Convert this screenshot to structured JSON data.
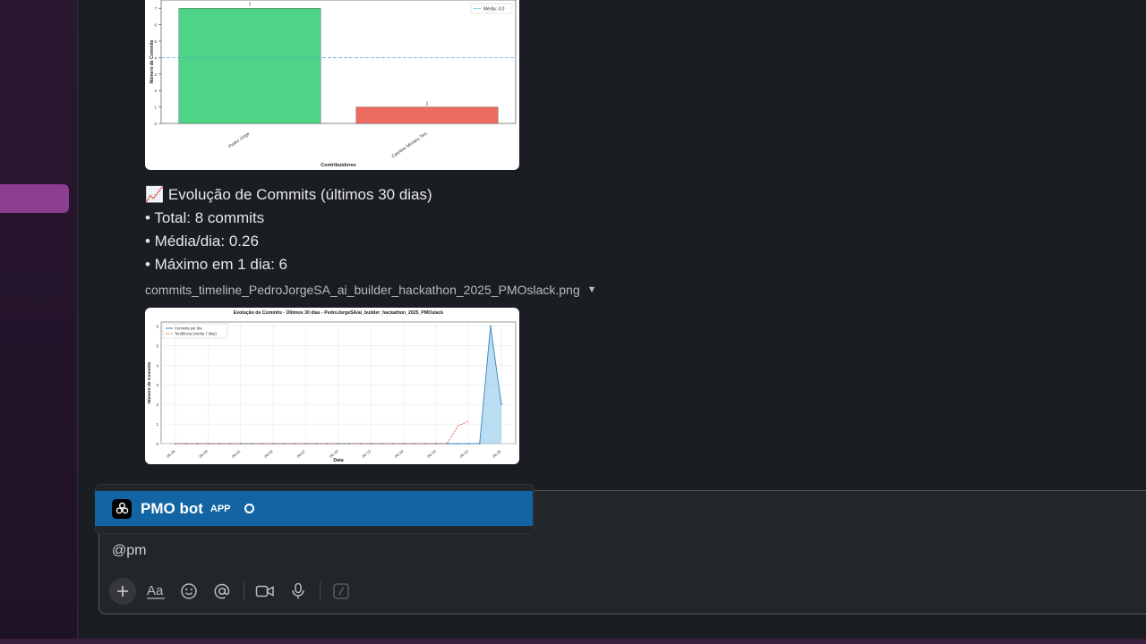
{
  "message": {
    "timeline_title": "📈 Evolução de Commits (últimos 30 dias)",
    "total": "• Total: 8 commits",
    "avg": "• Média/dia: 0.26",
    "max": "• Máximo em 1 dia: 6",
    "file_name": "commits_timeline_PedroJorgeSA_ai_builder_hackathon_2025_PMOslack.png"
  },
  "composer": {
    "text": "@pm"
  },
  "mention": {
    "name": "PMO bot",
    "badge": "APP"
  },
  "colors": {
    "accent_selected": "#1264a3",
    "sidebar_active": "#8c3f8f",
    "bar_green": "#4ed487",
    "bar_red": "#ec6a5e"
  },
  "chart_data": [
    {
      "type": "bar",
      "categories": [
        "Pedro Jorge",
        "Caroline Moraes Tsis"
      ],
      "values": [
        7,
        1
      ],
      "xlabel": "Contribuidores",
      "ylabel": "Número de Commits",
      "ylim": [
        0,
        7.5
      ],
      "yticks": [
        0,
        1,
        2,
        3,
        4,
        5,
        6,
        7
      ],
      "reference_line": {
        "label": "Média: 4.0",
        "value": 4.0
      },
      "legend": "top-right",
      "grid": false
    },
    {
      "type": "line",
      "title": "Evolução de Commits - Últimos 30 dias - PedroJorgeSA/ai_builder_hackathon_2025_PMOslack",
      "xlabel": "Data",
      "ylabel": "Número de Commits",
      "ylim": [
        0,
        6.2
      ],
      "yticks": [
        0,
        1,
        2,
        3,
        4,
        5,
        6
      ],
      "x_tick_labels": [
        "05-26",
        "05-29",
        "06-01",
        "06-04",
        "06-07",
        "06-10",
        "06-13",
        "06-16",
        "06-19",
        "06-22",
        "06-25"
      ],
      "legend": "top-left",
      "grid": true,
      "series": [
        {
          "name": "Commits por dia",
          "values": [
            0,
            0,
            0,
            0,
            0,
            0,
            0,
            0,
            0,
            0,
            0,
            0,
            0,
            0,
            0,
            0,
            0,
            0,
            0,
            0,
            0,
            0,
            0,
            0,
            0,
            0,
            0,
            0,
            0,
            6,
            2
          ]
        },
        {
          "name": "Tendência (média 7 dias)",
          "values": [
            0,
            0,
            0,
            0,
            0,
            0,
            0,
            0,
            0,
            0,
            0,
            0,
            0,
            0,
            0,
            0,
            0,
            0,
            0,
            0,
            0,
            0,
            0,
            0,
            0,
            0,
            0.9,
            1.15,
            null,
            null,
            null
          ]
        }
      ]
    }
  ]
}
